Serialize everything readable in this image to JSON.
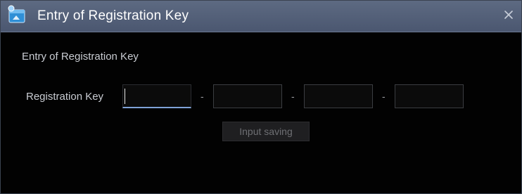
{
  "window": {
    "title": "Entry of Registration Key",
    "close_glyph": "×"
  },
  "icons": {
    "app": "app-window-icon",
    "close": "close-icon"
  },
  "section": {
    "title": "Entry of Registration Key"
  },
  "registration": {
    "label": "Registration Key",
    "separator": "-",
    "fields": [
      {
        "value": "",
        "active": true
      },
      {
        "value": "",
        "active": false
      },
      {
        "value": "",
        "active": false
      },
      {
        "value": "",
        "active": false
      }
    ]
  },
  "actions": {
    "input_saving_label": "Input saving",
    "input_saving_enabled": false
  },
  "colors": {
    "titlebar": "#55627a",
    "background": "#020202",
    "text": "#c9ccd2",
    "focus_underline": "#7fa2d8",
    "disabled_button_text": "#6e6f73"
  }
}
